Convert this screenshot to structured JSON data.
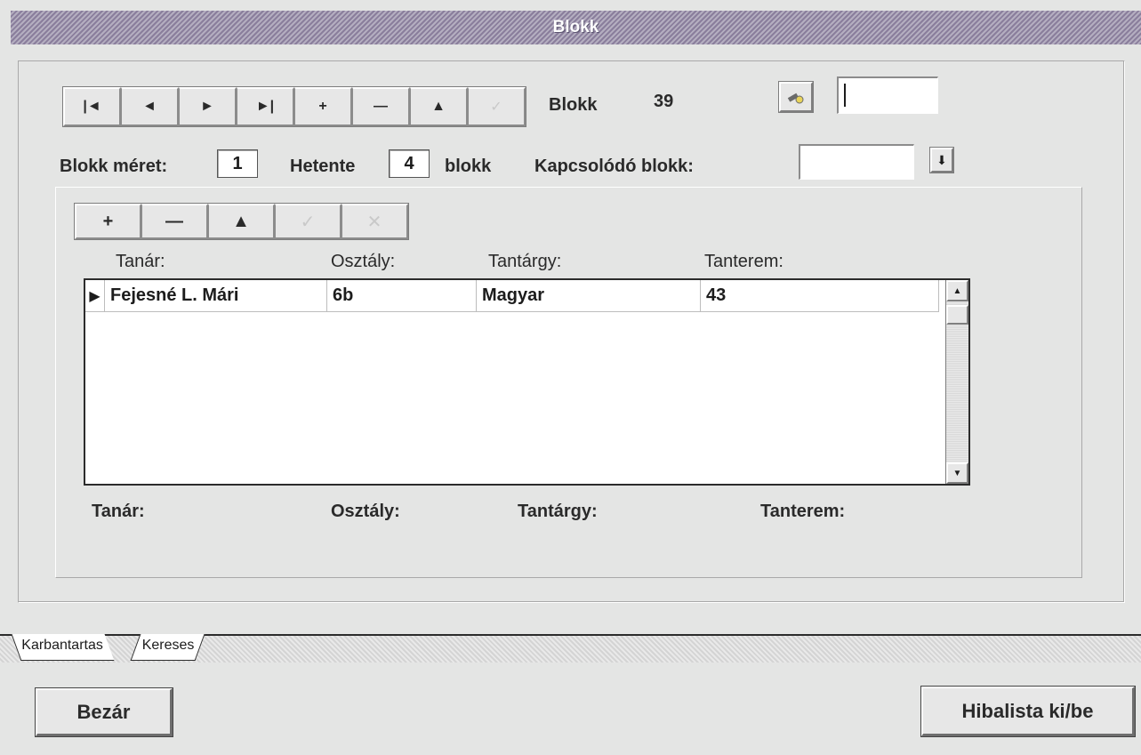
{
  "window": {
    "title": "Blokk"
  },
  "navigator": {
    "buttons": [
      {
        "name": "first-record-button",
        "glyph": "|◄",
        "disabled": false
      },
      {
        "name": "prior-record-button",
        "glyph": "◄",
        "disabled": false
      },
      {
        "name": "next-record-button",
        "glyph": "►",
        "disabled": false
      },
      {
        "name": "last-record-button",
        "glyph": "►|",
        "disabled": false
      },
      {
        "name": "insert-record-button",
        "glyph": "+",
        "disabled": false
      },
      {
        "name": "delete-record-button",
        "glyph": "—",
        "disabled": false
      },
      {
        "name": "edit-record-button",
        "glyph": "▲",
        "disabled": false
      },
      {
        "name": "post-record-button",
        "glyph": "✓",
        "disabled": true
      }
    ]
  },
  "header": {
    "blokk_label": "Blokk",
    "blokk_value": "39",
    "search_value": ""
  },
  "settings": {
    "size_label": "Blokk méret:",
    "size_value": "1",
    "weekly_label": "Hetente",
    "weekly_value": "4",
    "weekly_suffix": "blokk",
    "linked_label": "Kapcsolódó blokk:",
    "linked_value": ""
  },
  "detail_nav": {
    "buttons": [
      {
        "name": "detail-insert-button",
        "glyph": "+",
        "disabled": false
      },
      {
        "name": "detail-delete-button",
        "glyph": "—",
        "disabled": false
      },
      {
        "name": "detail-edit-button",
        "glyph": "▲",
        "disabled": false
      },
      {
        "name": "detail-post-button",
        "glyph": "✓",
        "disabled": true
      },
      {
        "name": "detail-cancel-button",
        "glyph": "✕",
        "disabled": true
      }
    ]
  },
  "grid": {
    "columns": [
      "Tanár:",
      "Osztály:",
      "Tantárgy:",
      "Tanterem:"
    ],
    "rows": [
      {
        "teacher": "Fejesné L. Mári",
        "class": "6b",
        "subject": "Magyar",
        "room": "43"
      }
    ]
  },
  "footer_labels": {
    "teacher": "Tanár:",
    "class": "Osztály:",
    "subject": "Tantárgy:",
    "room": "Tanterem:"
  },
  "tabs": [
    {
      "label": "Karbantartas",
      "active": true
    },
    {
      "label": "Kereses",
      "active": false
    }
  ],
  "actions": {
    "close_label": "Bezár",
    "errorlist_label": "Hibalista ki/be"
  }
}
